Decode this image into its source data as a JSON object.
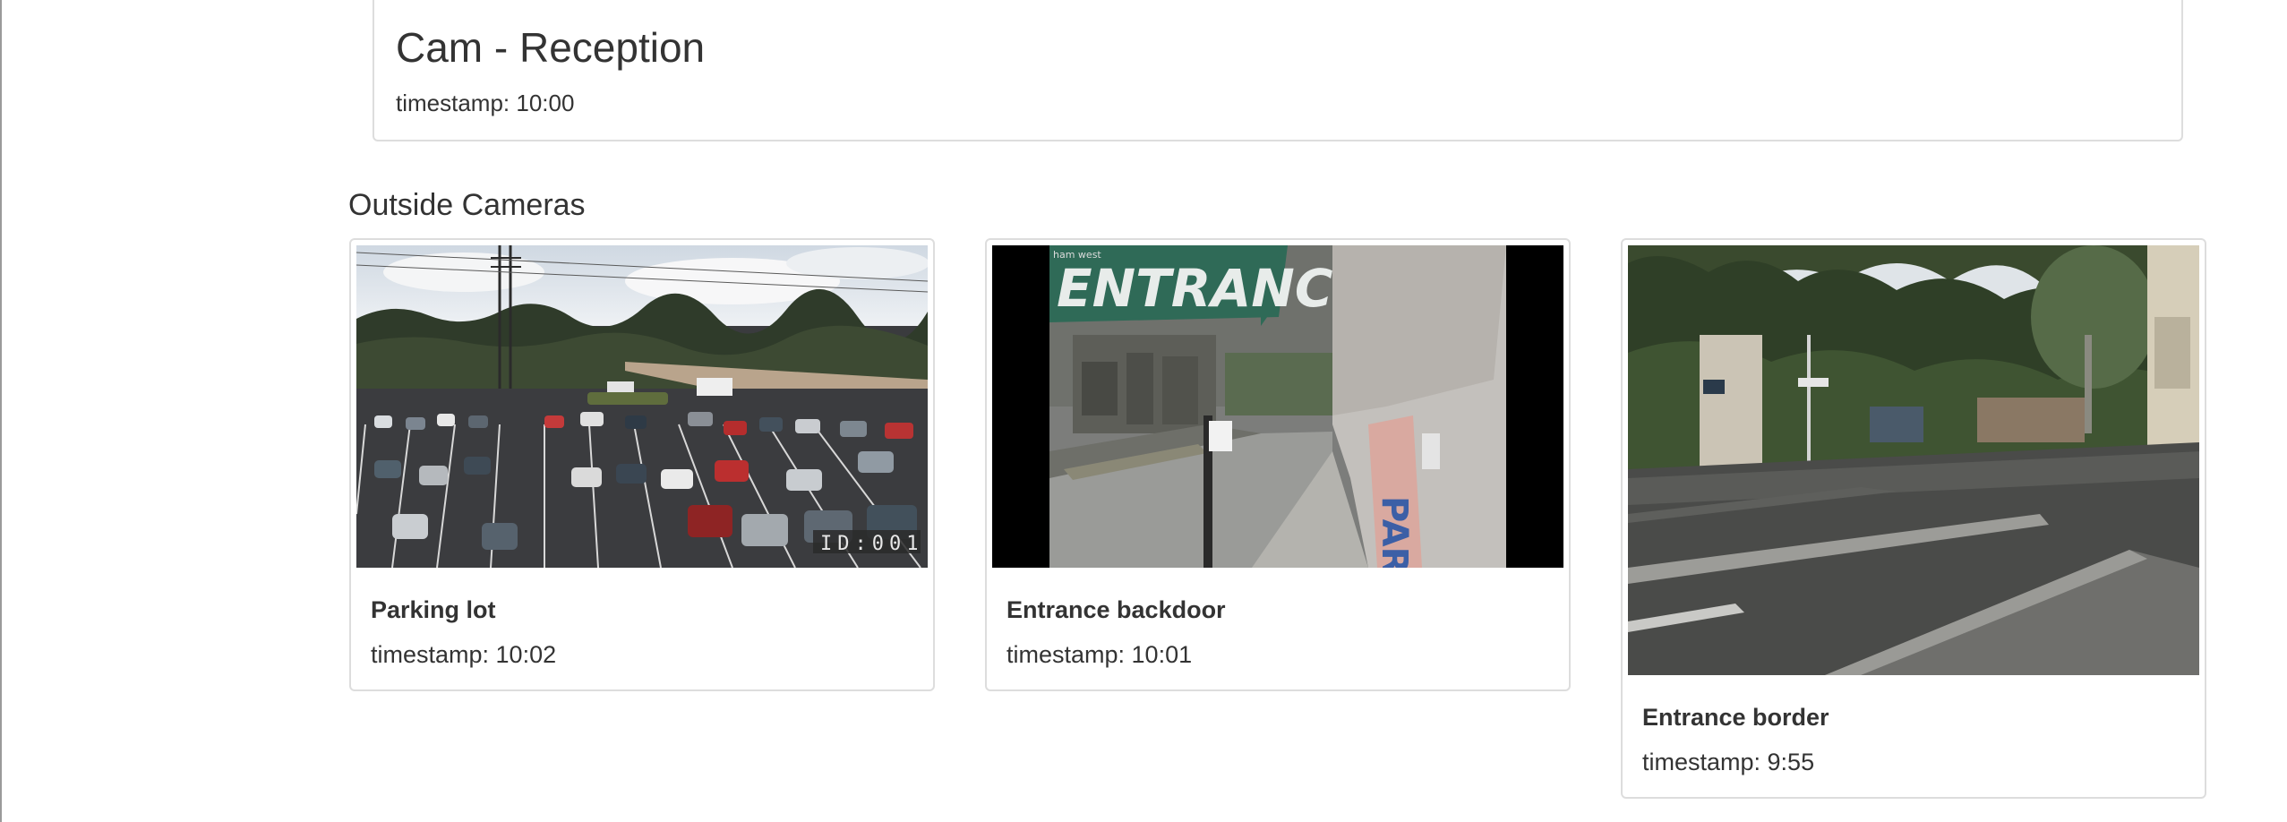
{
  "reception_camera": {
    "title": "Cam - Reception",
    "timestamp": "timestamp: 10:00"
  },
  "outside_section": {
    "heading": "Outside Cameras",
    "cameras": [
      {
        "name": "Parking lot",
        "timestamp": "timestamp: 10:02",
        "overlay_text": "ID:001"
      },
      {
        "name": "Entrance backdoor",
        "timestamp": "timestamp: 10:01",
        "overlay_text": "ham west",
        "sign_text": "ENTRANCE",
        "side_sign_text": "PARK"
      },
      {
        "name": "Entrance border",
        "timestamp": "timestamp: 9:55"
      }
    ]
  },
  "colors": {
    "card_border": "#dddddd",
    "text": "#333333"
  }
}
